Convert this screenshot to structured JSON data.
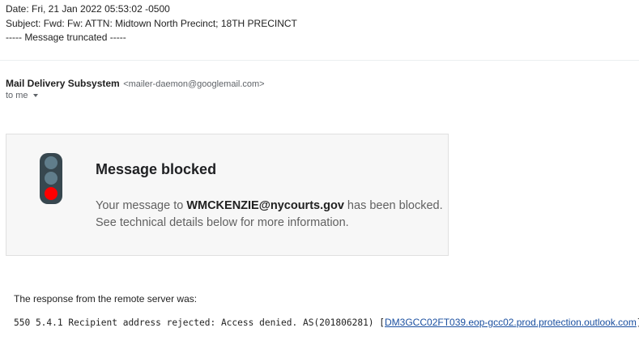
{
  "quoted_header": {
    "date_line": "Date: Fri, 21 Jan 2022 05:53:02 -0500",
    "subject_line": "Subject: Fwd: Fw: ATTN: Midtown North Precinct; 18TH PRECINCT",
    "truncated_line": "----- Message truncated -----"
  },
  "sender": {
    "name": "Mail Delivery Subsystem",
    "email": "<mailer-daemon@googlemail.com>",
    "to_label": "to me"
  },
  "blocked_card": {
    "icon": "traffic-light-icon",
    "title": "Message blocked",
    "body_prefix": "Your message to ",
    "recipient": "WMCKENZIE@nycourts.gov",
    "body_suffix": " has been blocked.",
    "body_line2": "See technical details below for more information."
  },
  "response": {
    "label": "The response from the remote server was:",
    "code_text": "550 5.4.1 Recipient address rejected: Access denied. AS(201806281) [",
    "server_link": "DM3GCC02FT039.eop-gcc02.prod.protection.outlook.com",
    "closing": "]"
  },
  "colors": {
    "lamp_off": "#607d8b",
    "lamp_on": "#ff0000",
    "light_body": "#37474f",
    "link": "#1a4fa0"
  }
}
